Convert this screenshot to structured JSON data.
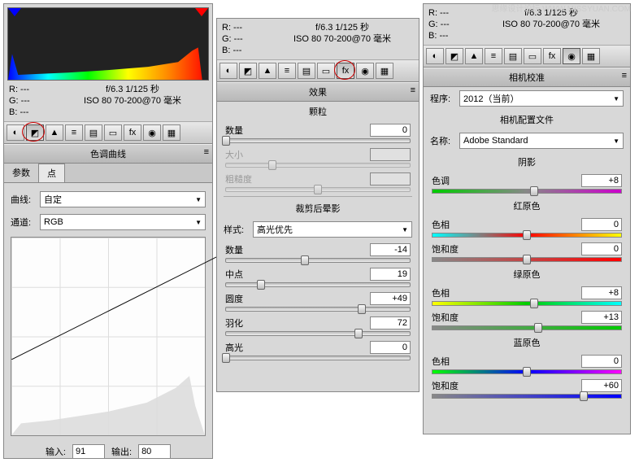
{
  "watermark": "思缘设计论坛 WWW.MISSYUAN.COM",
  "rgb": {
    "r": "R:  ---",
    "g": "G:  ---",
    "b": "B:  ---"
  },
  "exposure": {
    "line1": "f/6.3   1/125 秒",
    "line2": "ISO 80   70-200@70 毫米"
  },
  "panel1": {
    "header": "色调曲线",
    "tabs": {
      "params": "参数",
      "points": "点"
    },
    "curve_label": "曲线:",
    "curve_value": "自定",
    "channel_label": "通道:",
    "channel_value": "RGB",
    "input_label": "输入:",
    "input_value": "91",
    "output_label": "输出:",
    "output_value": "80"
  },
  "panel2": {
    "header": "效果",
    "grain_title": "颗粒",
    "grain_amount_label": "数量",
    "grain_amount_value": "0",
    "grain_size_label": "大小",
    "grain_rough_label": "粗糙度",
    "vignette_title": "裁剪后晕影",
    "style_label": "样式:",
    "style_value": "高光优先",
    "amount_label": "数量",
    "amount_value": "-14",
    "midpoint_label": "中点",
    "midpoint_value": "19",
    "roundness_label": "圆度",
    "roundness_value": "+49",
    "feather_label": "羽化",
    "feather_value": "72",
    "highlight_label": "高光",
    "highlight_value": "0"
  },
  "panel3": {
    "header": "相机校准",
    "process_label": "程序:",
    "process_value": "2012（当前）",
    "profile_title": "相机配置文件",
    "name_label": "名称:",
    "name_value": "Adobe Standard",
    "shadow_title": "阴影",
    "tint_label": "色调",
    "tint_value": "+8",
    "red_title": "红原色",
    "green_title": "绿原色",
    "blue_title": "蓝原色",
    "hue_label": "色相",
    "sat_label": "饱和度",
    "red_hue": "0",
    "red_sat": "0",
    "green_hue": "+8",
    "green_sat": "+13",
    "blue_hue": "0",
    "blue_sat": "+60"
  },
  "icons": {
    "basic": "◐",
    "curve": "◩",
    "detail": "▲",
    "hsl": "≡",
    "split": "▤",
    "lens": "▭",
    "fx": "fx",
    "cam": "◉",
    "preset": "▦"
  }
}
